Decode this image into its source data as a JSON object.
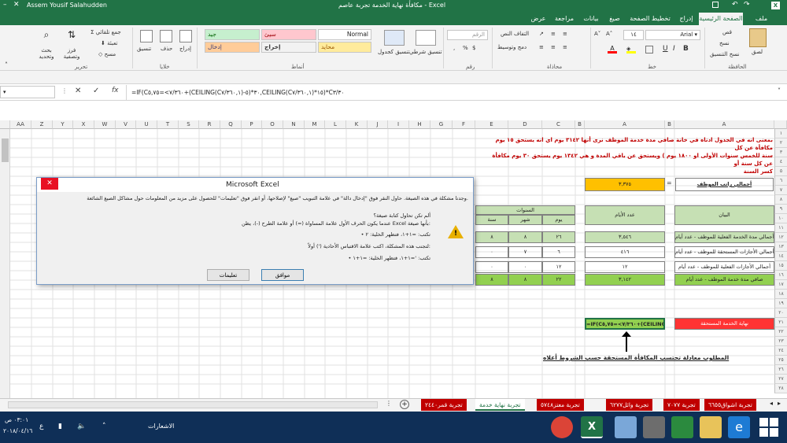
{
  "titlebar": {
    "title": "مكافأة نهاية الخدمة تجربة عاصم - Excel",
    "user": "Assem Yousif Salahudden"
  },
  "tabs": [
    "ملف",
    "الصفحة الرئيسية",
    "إدراج",
    "تخطيط الصفحة",
    "صيغ",
    "بيانات",
    "مراجعة",
    "عرض"
  ],
  "ribbon": {
    "clipboard": {
      "label": "الحافظة",
      "paste": "لصق",
      "cut": "قص",
      "copy": "نسخ",
      "painter": "نسخ التنسيق"
    },
    "font": {
      "label": "خط",
      "name": "Arial",
      "size": "١٤"
    },
    "alignment": {
      "label": "محاذاة",
      "wrap": "التفاف النص",
      "merge": "دمج وتوسيط"
    },
    "number": {
      "label": "رقم",
      "format": "الرقم"
    },
    "styles": {
      "label": "أنماط",
      "conditional": "تنسيق شرطي",
      "table": "تنسيق كجدول",
      "normal": "Normal",
      "bad": "سيئ",
      "good": "جيد",
      "neutral": "محايد",
      "output": "إخراج",
      "input": "إدخال"
    },
    "cells": {
      "label": "خلايا",
      "insert": "إدراج",
      "delete": "حذف",
      "format": "تنسيق"
    },
    "editing": {
      "label": "تحرير",
      "autosum": "جمع تلقائي",
      "fill": "تعبئة",
      "clear": "مسح",
      "sort": "فرز وتصفية",
      "find": "بحث وتحديد"
    }
  },
  "formula_bar": {
    "fx": "fx",
    "formula": "=IF(C٧/٣٦٠>=٥,٧٥+(CEILING(C٧/٣٦٠,١)-٥)*٣٠,CEILING(C٧/٣٦٠,١)*١٥)*C٣/٣٠"
  },
  "columns": [
    "AA",
    "Z",
    "Y",
    "X",
    "W",
    "V",
    "U",
    "T",
    "S",
    "R",
    "Q",
    "P",
    "O",
    "N",
    "M",
    "L",
    "K",
    "J",
    "I",
    "H",
    "G",
    "F",
    "E",
    "D",
    "C",
    "B",
    "A"
  ],
  "rows": [
    "١",
    "٢",
    "٣",
    "٤",
    "٥",
    "٦",
    "٧",
    "٨",
    "٩",
    "١٠",
    "١١",
    "١٢",
    "١٣",
    "١٤",
    "١٥",
    "١٦",
    "١٧",
    "١٨",
    "١٩",
    "٢٠",
    "٢١",
    "٢٢",
    "٢٣",
    "٢٤",
    "٢٥",
    "٢٦",
    "٢٧",
    "٢٨"
  ],
  "sheet": {
    "note_line1": "بمعنى انه في الجدول ادناه في خانة صافي مدة خدمة الموظف نرى أنها ٣١٤٢ يوم اي انه يستحق ١٥ يوم مكافأة عن كل",
    "note_line2": "سنة للخمس سنوات الأولى او ١٨٠٠ يوم ) ويستحق عن باقي المدة و هي ١٣٤٢ يوم يستحق ٣٠ يوم مكافأة عن كل سنة أو",
    "note_line3": "كسر السنة",
    "salary_label": "أجمالي راتب الموظف",
    "salary_eq": "=",
    "salary_value": "٣,٣٧٥",
    "header_years": "السنوات",
    "header_days": "عدد الأيام",
    "header_statement": "البيان",
    "h_day": "يوم",
    "h_month": "شهر",
    "h_year": "سنة",
    "table_rows": [
      {
        "label": "أجمالي مدة الخدمة الفعلية للموظف - عدد أيام",
        "days": "٣,٥٤٦",
        "d": "٢٦",
        "m": "٨",
        "y": "٨"
      },
      {
        "label": "أجمالي الأجازات المستحقة للموظف - عدد أيام",
        "days": "٤١٦",
        "d": "٦",
        "m": "٧",
        "y": "٠"
      },
      {
        "label": "أجمالي الأجازات الفعلية للموظف - عدد أيام",
        "days": "١٢",
        "d": "١٢",
        "m": "٠",
        "y": "٠"
      },
      {
        "label": "صافي مدة خدمة الموظف - عدد أيام",
        "days": "٣,١٤٢",
        "d": "٢٢",
        "m": "٨",
        "y": "٨"
      }
    ],
    "eos_label": "نهاية الخدمة المستحقة",
    "eos_formula": "=IF(C٧/٣٦٠>=٥,٧٥+(CEILING",
    "required_text": "المطلوب معادلة تحتسب المكافأة المستحقة حسب الشروط أعلاه"
  },
  "dialog": {
    "title": "Microsoft Excel",
    "line1": "وجدنا مشكلة في هذه الصيغة. حاول النقر فوق \"إدخال دالة\" في علامة التبويب \"صيغ\" لإصلاحها، أو انقر فوق \"تعليمات\" للحصول على مزيد من المعلومات حول مشاكل الصيغ الشائعة.",
    "line2": "ألم تكن تحاول كتابة صيغة؟",
    "line3": "عندما يكون الحرف الأول علامة المساواة (=) أو علامة الطرح (-)، يظن Excel بأنها صيغة:",
    "line4": "• تكتب: =١+١، فتظهر الخلية: ٢",
    "line5": "لتجنب هذه المشكلة، اكتب علامة الاقتباس الأحادية (') أولاً:",
    "line6": "• تكتب: '=١+١، فتظهر الخلية: =١+١",
    "ok": "موافق",
    "help": "تعليمات"
  },
  "sheet_tabs": [
    "تجربة اشواق٦٦٥٥",
    "تجربة ٧٠٧٧",
    "تجربة وائل٦٢٧٧",
    "تجربة معتز٥٧٤٨",
    "تجربة نهاية خدمة",
    "تجربة قمر٢٤٤٠"
  ],
  "taskbar": {
    "time": "٠٣:٠١ ص",
    "date": "٢٠١٨/٠٤/١٦",
    "lang": "ع",
    "notif": "الاشعارات"
  }
}
